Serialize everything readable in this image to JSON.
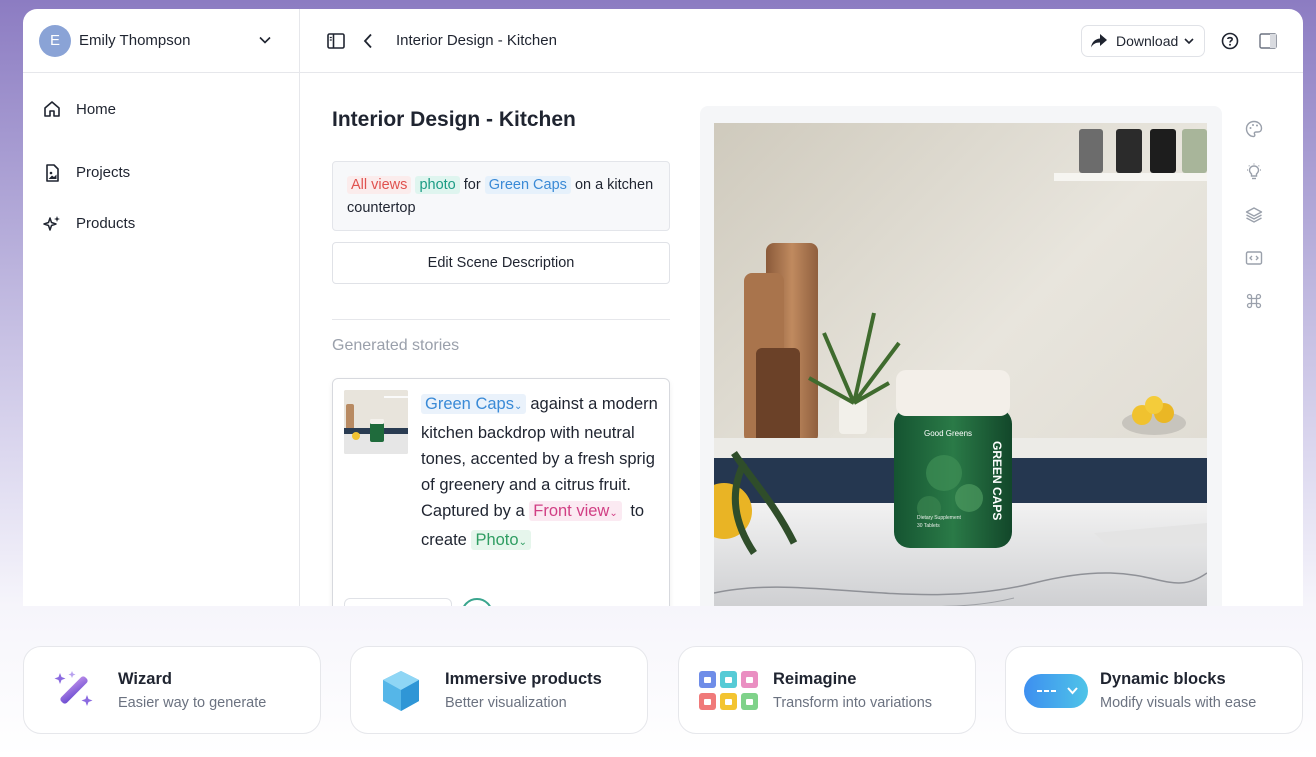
{
  "user": {
    "initial": "E",
    "name": "Emily Thompson"
  },
  "sidebar": {
    "items": [
      {
        "label": "Home",
        "icon": "home-icon"
      },
      {
        "label": "Projects",
        "icon": "document-image-icon"
      },
      {
        "label": "Products",
        "icon": "sparkles-icon"
      }
    ]
  },
  "topbar": {
    "title": "Interior Design - Kitchen",
    "download_label": "Download"
  },
  "page": {
    "title": "Interior Design - Kitchen",
    "scene": {
      "views": "All views",
      "type": "photo",
      "word_for": "for",
      "product": "Green Caps",
      "rest": "on a kitchen countertop"
    },
    "edit_button": "Edit Scene Description",
    "generated_label": "Generated stories",
    "story": {
      "product_tag": "Green Caps",
      "text1": "against a modern kitchen backdrop with neutral tones, accented by a fresh sprig of greenery and a citrus fruit. Captured by a",
      "view_tag": "Front view",
      "text2": "to create",
      "type_tag": "Photo"
    }
  },
  "image": {
    "brand": "Good Greens",
    "product_name": "GREEN CAPS",
    "supplement": "Dietary Supplement",
    "count": "30 Tablets"
  },
  "features": [
    {
      "title": "Wizard",
      "subtitle": "Easier way to generate",
      "icon": "magic-wand-icon"
    },
    {
      "title": "Immersive products",
      "subtitle": "Better visualization",
      "icon": "cube-icon"
    },
    {
      "title": "Reimagine",
      "subtitle": "Transform into variations",
      "icon": "grid-variations-icon"
    },
    {
      "title": "Dynamic blocks",
      "subtitle": "Modify visuals with ease",
      "icon": "dropdown-pill-icon"
    }
  ],
  "colors": {
    "accent_red": "#e0524f",
    "accent_teal": "#1b9c85",
    "accent_blue": "#3a8ad6",
    "accent_pink": "#d13f84",
    "accent_green": "#2f9d62"
  }
}
